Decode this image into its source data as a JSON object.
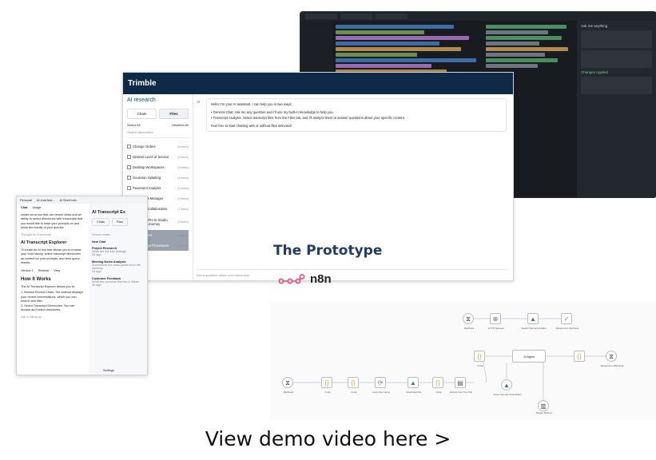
{
  "editor": {
    "chat_title": "Ask me anything",
    "changes_applied": "Changes Applied"
  },
  "ai_research": {
    "brand": "Trimble",
    "title": "AI research",
    "tabs": [
      "Chats",
      "Files"
    ],
    "select_all": "Select All",
    "deselect_all": "Deselect All",
    "search_placeholder": "Search directories...",
    "directories": [
      {
        "name": "Change Orders",
        "count": "(8 items)"
      },
      {
        "name": "Desired Level of Service",
        "count": "(2 items)"
      },
      {
        "name": "Desktop Workspaces",
        "count": "(5 items)"
      },
      {
        "name": "Gaussian Splatting",
        "count": "(4 items)"
      },
      {
        "name": "Pavement Analysis",
        "count": "(3 items)"
      },
      {
        "name": "Portal Task Manager",
        "count": "(2 items)"
      },
      {
        "name": "Keystone Collaboration",
        "count": "(7 items)"
      },
      {
        "name": "SketchUp Pro to Studio Customer Journey",
        "count": "(3 items)"
      },
      {
        "name": "Smart Forms",
        "count": "(7 items)"
      },
      {
        "name": "Word Merge Processors",
        "count": "(3 items)"
      }
    ],
    "avatar": "AI",
    "message": {
      "greeting": "Hello! I'm your AI assistant. I can help you in two ways:",
      "point1": "• General Chat: Ask me any question and I'll use my built-in knowledge to help you.",
      "point2": "• Transcript Analysis: Select transcript files from the Files tab, and I'll analyze them to answer questions about your specific content.",
      "closing": "Feel free to start chatting with or without files selected!"
    },
    "input_placeholder": "Ask a question about your transcripts..."
  },
  "chat_window": {
    "tabs": [
      "Personal",
      "AI chat feat...",
      "AI Shell butt..."
    ],
    "left_tabs": [
      "Chat",
      "Usage"
    ],
    "intro": "create an ai tool that can recent chats and an ability to select directories with transcripts that you would like to base your prompts on and show the results of your queries",
    "thought": "Thought for 8 seconds",
    "heading": "AI Transcript Explorer",
    "desc": "I'll create an AI tool that allows you to browse your chat history, select transcript directories as context for your prompts, and view query results.",
    "version": "Version 1",
    "restore": "Restore",
    "view": "View",
    "how": "How It Works",
    "how_desc": "The AI Transcript Explorer allows you to:",
    "step1": "1. Browse Recent Chats: The sidebar displays your recent conversations, which you can search and filter",
    "step2": "2. Select Transcript Directories: You can browse and select directories",
    "followup": "Ask a follow-up...",
    "right_title": "AI Transcript Ex",
    "right_tabs": [
      "Chats",
      "Files"
    ],
    "search": "Search chats...",
    "new_chat": "New Chat",
    "recent": [
      {
        "title": "Project Research",
        "desc": "What are the key findings",
        "time": "2d ago"
      },
      {
        "title": "Meeting Notes Analysis",
        "desc": "Summarize the main points from the meeting",
        "time": "1d ago"
      },
      {
        "title": "Customer Feedback",
        "desc": "What are common themes in these",
        "time": "3d ago"
      }
    ],
    "settings": "Settings"
  },
  "prototype": {
    "title": "The Prototype",
    "logo_text": "n8n"
  },
  "flow": {
    "ai_agent": "AI Agent",
    "labels": [
      "Webhook",
      "Code",
      "Code",
      "Loop Over Items",
      "Download File",
      "Code",
      "Extract from Text File",
      "Webhook",
      "HTTP Request",
      "Search files and folders",
      "Respond to Webhook",
      "Code",
      "Respond to Webhook",
      "Azure OpenAI Chat Model",
      "Simple Memory"
    ]
  },
  "caption": "View demo video here >"
}
